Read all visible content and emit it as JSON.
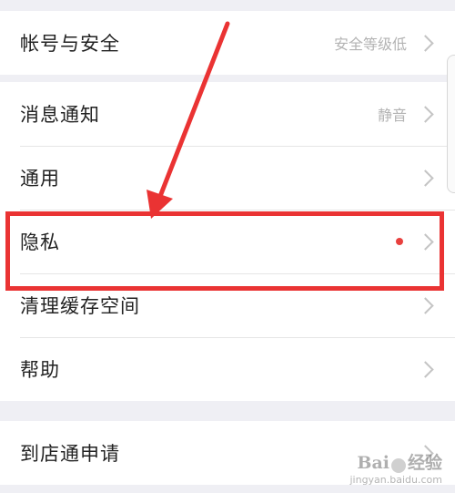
{
  "settings": {
    "group1": [
      {
        "label": "帐号与安全",
        "value": "安全等级低"
      }
    ],
    "group2": [
      {
        "label": "消息通知",
        "value": "静音"
      },
      {
        "label": "通用",
        "value": ""
      },
      {
        "label": "隐私",
        "value": ""
      },
      {
        "label": "清理缓存空间",
        "value": ""
      },
      {
        "label": "帮助",
        "value": ""
      }
    ],
    "group3": [
      {
        "label": "到店通申请",
        "value": ""
      }
    ]
  },
  "colors": {
    "highlight": "#ea3333",
    "badge_dot": "#e8403e",
    "background": "#efeff4"
  },
  "watermark": {
    "brand_left": "Bai",
    "brand_right": "经验",
    "url": "jingyan.baidu.com"
  }
}
